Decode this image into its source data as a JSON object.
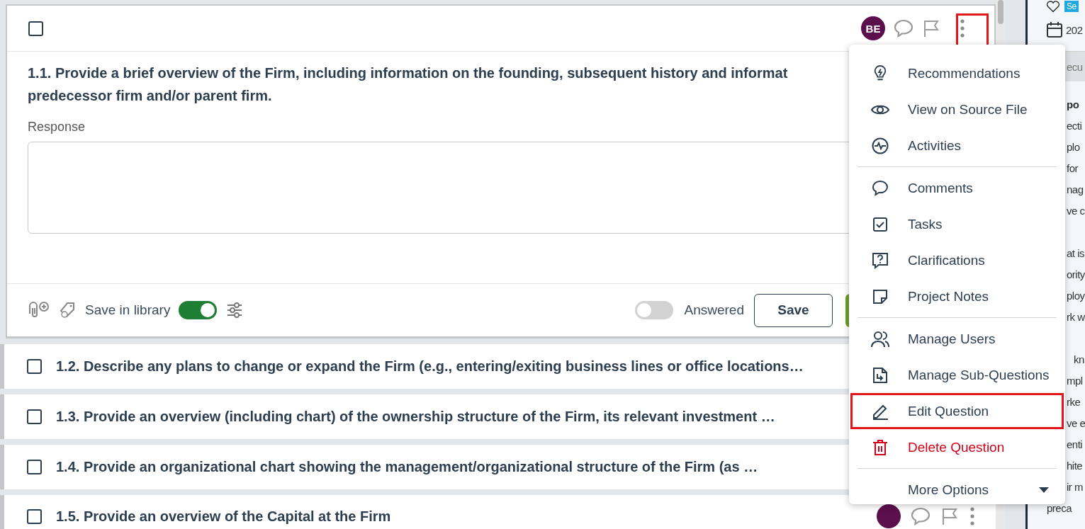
{
  "open_question": {
    "checked": false,
    "avatar": "BE",
    "more_highlighted": true,
    "lines": [
      "1.1. Provide a brief overview of the Firm, including information on the founding, subsequent history and informat",
      "predecessor firm and/or parent firm."
    ],
    "response_label": "Response",
    "save_in_library": {
      "label": "Save in library",
      "on": true
    },
    "answered": {
      "label": "Answered",
      "on": false
    },
    "save_button": "Save"
  },
  "questions": [
    {
      "text": "1.2. Describe any plans to change or expand the Firm (e.g., entering/exiting business lines or office locations…",
      "checked": false
    },
    {
      "text": "1.3. Provide an overview (including chart) of the ownership structure of the Firm, its relevant investment …",
      "checked": false
    },
    {
      "text": "1.4. Provide an organizational chart showing the management/organizational structure of the Firm (as …",
      "checked": false
    },
    {
      "text": "1.5. Provide an overview of the Capital at the Firm",
      "checked": false
    }
  ],
  "menu": {
    "groups": [
      [
        {
          "label": "Recommendations",
          "kind": "action",
          "highlighted": false
        },
        {
          "label": "View on Source File",
          "kind": "action",
          "highlighted": false
        },
        {
          "label": "Activities",
          "kind": "action",
          "highlighted": false
        }
      ],
      [
        {
          "label": "Comments",
          "kind": "action",
          "highlighted": false
        },
        {
          "label": "Tasks",
          "kind": "action",
          "highlighted": false
        },
        {
          "label": "Clarifications",
          "kind": "action",
          "highlighted": false
        },
        {
          "label": "Project Notes",
          "kind": "action",
          "highlighted": false
        }
      ],
      [
        {
          "label": "Manage Users",
          "kind": "action",
          "highlighted": false
        },
        {
          "label": "Manage Sub-Questions",
          "kind": "action",
          "highlighted": false
        },
        {
          "label": "Edit Question",
          "kind": "action",
          "highlighted": true
        },
        {
          "label": "Delete Question",
          "kind": "danger",
          "highlighted": false
        }
      ],
      [
        {
          "label": "More Options",
          "kind": "expand",
          "highlighted": false
        }
      ]
    ]
  },
  "side_panel": {
    "badge": "Se",
    "date": "202",
    "section_tab": "ecu",
    "heading": "po",
    "paragraphs": [
      [
        "ecti",
        "plo",
        "for",
        "nag",
        "ve c"
      ],
      [
        "at is",
        "ority",
        "ploy",
        "rk w"
      ],
      [
        "kn",
        "mpl",
        "rke",
        "ve e",
        "enti",
        "hite",
        "ir m",
        "preca"
      ]
    ]
  }
}
